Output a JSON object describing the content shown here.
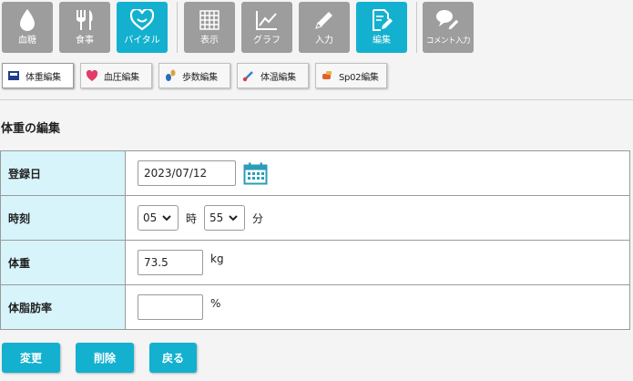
{
  "topnav": {
    "items": [
      {
        "label": "血糖",
        "icon": "drop-icon"
      },
      {
        "label": "食事",
        "icon": "fork-knife-icon"
      },
      {
        "label": "バイタル",
        "icon": "heart-smile-icon",
        "active": true
      },
      {
        "label": "表示",
        "icon": "grid-icon"
      },
      {
        "label": "グラフ",
        "icon": "chart-icon"
      },
      {
        "label": "入力",
        "icon": "pencil-icon"
      },
      {
        "label": "編集",
        "icon": "edit-doc-icon",
        "active": true
      },
      {
        "label": "コメント入力",
        "icon": "comment-pencil-icon"
      }
    ]
  },
  "subtabs": [
    {
      "label": "体重編集",
      "icon": "weight-scale-icon",
      "active": true
    },
    {
      "label": "血圧編集",
      "icon": "heart-monitor-icon"
    },
    {
      "label": "歩数編集",
      "icon": "footprint-icon"
    },
    {
      "label": "体温編集",
      "icon": "thermometer-icon"
    },
    {
      "label": "Sp02編集",
      "icon": "oximeter-icon"
    }
  ],
  "section_title": "体重の編集",
  "form": {
    "date_label": "登録日",
    "date_value": "2023/07/12",
    "time_label": "時刻",
    "hour_value": "05",
    "hour_unit": "時",
    "minute_value": "55",
    "minute_unit": "分",
    "weight_label": "体重",
    "weight_value": "73.5",
    "weight_unit": "kg",
    "fat_label": "体脂肪率",
    "fat_value": "",
    "fat_unit": "%"
  },
  "actions": {
    "update": "変更",
    "delete": "削除",
    "back": "戻る"
  },
  "colors": {
    "accent": "#13b1cf",
    "nav_inactive": "#9d9d9d",
    "label_cell": "#d7f4fb",
    "calendar": "#2a9db8"
  }
}
